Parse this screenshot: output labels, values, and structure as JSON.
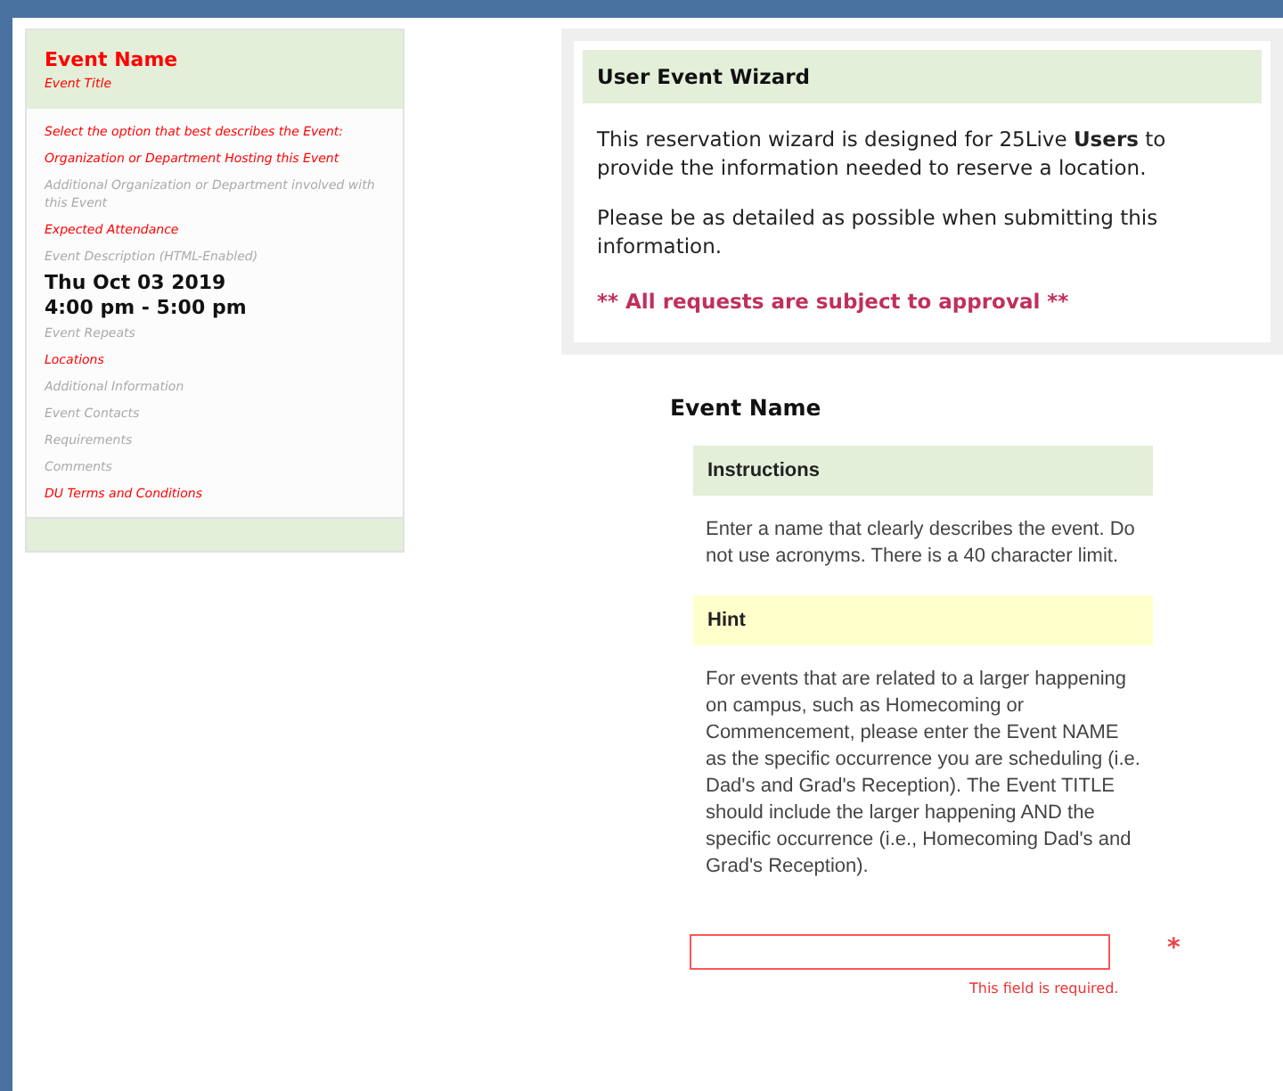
{
  "sidebar": {
    "title": "Event Name",
    "subtitle": "Event Title",
    "items": [
      {
        "kind": "required",
        "text": "Select the option that best describes the Event:"
      },
      {
        "kind": "required",
        "text": "Organization or Department Hosting this Event"
      },
      {
        "kind": "optional",
        "text": "Additional Organization or Department involved with this Event"
      },
      {
        "kind": "required",
        "text": "Expected Attendance"
      },
      {
        "kind": "optional",
        "text": "Event Description (HTML-Enabled)"
      },
      {
        "kind": "datetime",
        "text": "Thu Oct 03 2019"
      },
      {
        "kind": "datetime",
        "text": "4:00 pm - 5:00 pm"
      },
      {
        "kind": "optional",
        "text": "Event Repeats"
      },
      {
        "kind": "required",
        "text": "Locations"
      },
      {
        "kind": "optional",
        "text": "Additional Information"
      },
      {
        "kind": "optional",
        "text": "Event Contacts"
      },
      {
        "kind": "optional",
        "text": "Requirements"
      },
      {
        "kind": "optional",
        "text": "Comments"
      },
      {
        "kind": "required",
        "text": "DU Terms and Conditions"
      }
    ]
  },
  "wizard": {
    "title": "User Event Wizard",
    "paragraphs": [
      "This reservation wizard is designed for 25Live **Users** to provide the information needed to reserve a location.",
      "Please be as detailed as possible when submitting this information."
    ],
    "notice": "** All requests are subject to approval **"
  },
  "section": {
    "title": "Event Name",
    "instructions": {
      "title": "Instructions",
      "text": "Enter a name that clearly describes the event. Do not use acronyms. There is a 40 character limit."
    },
    "hint": {
      "title": "Hint",
      "text": "For events that are related to a larger happening on campus, such as Homecoming or Commencement, please enter the Event NAME as the specific occurrence you are scheduling (i.e. Dad's and Grad's Reception). The Event TITLE should include the larger happening AND the specific occurrence (i.e., Homecoming Dad's and Grad's Reception)."
    },
    "field": {
      "required_mark": "*",
      "error": "This field is required."
    }
  }
}
